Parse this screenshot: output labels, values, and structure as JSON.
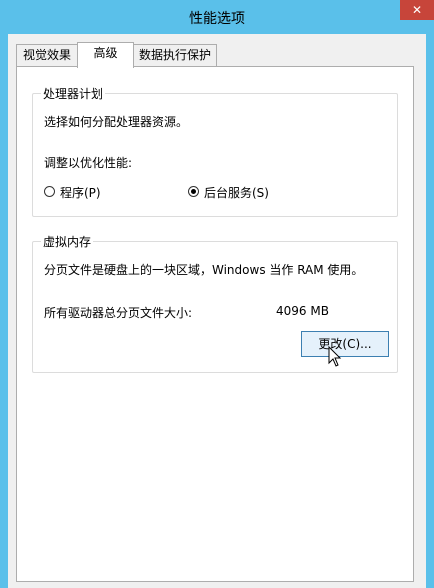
{
  "window": {
    "title": "性能选项",
    "close_glyph": "✕",
    "titlebar_color": "#5ac0ea",
    "close_color": "#c7453a"
  },
  "tabs": [
    {
      "label": "视觉效果"
    },
    {
      "label": "高级"
    },
    {
      "label": "数据执行保护"
    }
  ],
  "active_tab": "高级",
  "processor": {
    "group_label": "处理器计划",
    "description": "选择如何分配处理器资源。",
    "adjust_label": "调整以优化性能:",
    "options": [
      {
        "label": "程序(P)",
        "checked": false
      },
      {
        "label": "后台服务(S)",
        "checked": true
      }
    ]
  },
  "virtual_memory": {
    "group_label": "虚拟内存",
    "description": "分页文件是硬盘上的一块区域，Windows 当作 RAM 使用。",
    "total_label": "所有驱动器总分页文件大小:",
    "total_value": "4096 MB",
    "change_button": "更改(C)..."
  },
  "icons": {
    "close": "close-icon",
    "cursor": "mouse-cursor-icon"
  }
}
